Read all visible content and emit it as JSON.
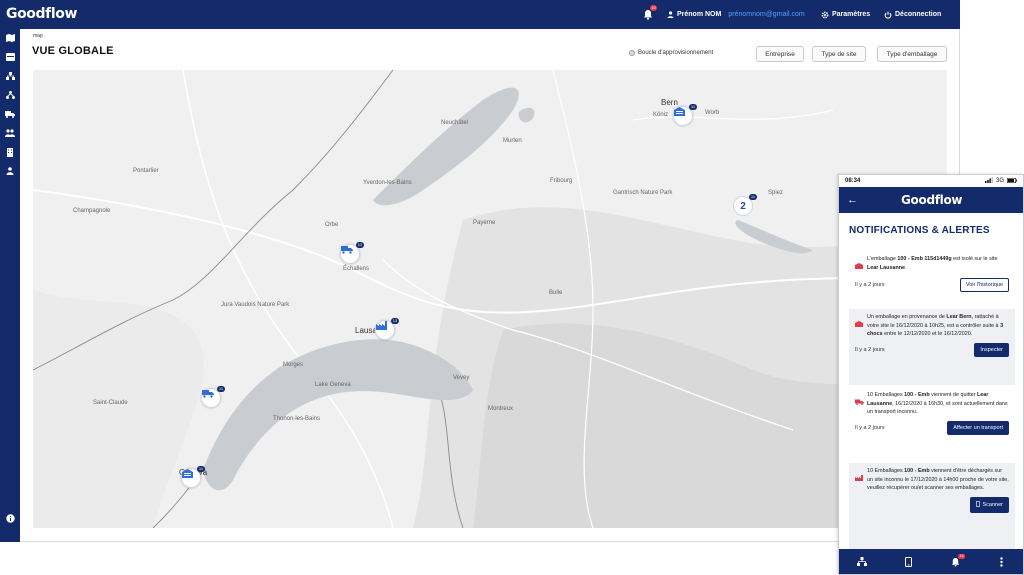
{
  "app": {
    "brand": "Goodflow"
  },
  "topbar": {
    "notification_count": "10",
    "user_name": "Prénom NOM",
    "user_email": "prénomnom@gmail.com",
    "settings_label": "Paramètres",
    "logout_label": "Déconnection"
  },
  "sidebar": {
    "items": [
      "map-icon",
      "inventory-icon",
      "network-icon",
      "hierarchy-icon",
      "truck-icon",
      "team-icon",
      "building-icon",
      "users-icon",
      "info-icon"
    ]
  },
  "page": {
    "breadcrumb": "map",
    "title": "VUE GLOBALE",
    "loop_label": "Boucle d'approvisionnement",
    "filters": [
      "Entreprise",
      "Type de site",
      "Type d'emballage"
    ]
  },
  "map": {
    "cities": [
      "Bern",
      "Köniz",
      "Worb",
      "Fribourg",
      "Yverdon-les-Bains",
      "Lausanne",
      "Geneva",
      "Lake Geneva",
      "Neuchâtel",
      "Morges",
      "Vevey",
      "Bulle",
      "Pontarlier",
      "Thonon-les-Bains",
      "Échallens",
      "Orbe",
      "Spiez",
      "Gantrisch Nature Park",
      "Jura Vaudois Nature Park",
      "Champagnole",
      "Saint-Claude",
      "Montreux",
      "Murten",
      "Payerne"
    ],
    "markers": [
      {
        "icon": "warehouse-icon",
        "badge": "11"
      },
      {
        "icon": "truck-icon",
        "badge": "12"
      },
      {
        "icon": "factory-icon",
        "badge": "13"
      },
      {
        "icon": "truck-icon",
        "badge": "11"
      },
      {
        "icon": "warehouse-icon",
        "badge": "11"
      }
    ],
    "cluster_count": "2",
    "cluster_badge": "11"
  },
  "phone": {
    "time": "08:34",
    "signal": "3G",
    "brand": "Goodflow",
    "title": "NOTIFICATIONS & ALERTES",
    "cards": [
      {
        "parts": [
          "L'emballage ",
          "100 - Emb 115d1449g",
          " est isolé sur le site ",
          "Lear Lausanne",
          "."
        ],
        "time": "Il y a 2 jours",
        "action": "Voir l'historique"
      },
      {
        "parts": [
          "Un emballage en provenance de ",
          "Lear Bern",
          ", rattaché à votre site le 16/12/2020 à 10h25, est a contrôler suite à ",
          "3 chocs",
          " entre le 12/12/2020 et le 16/12/2020."
        ],
        "time": "Il y a 2 jours",
        "action": "Inspecter"
      },
      {
        "parts": [
          "10 Emballages ",
          "100 - Emb",
          " viennent de quitter ",
          "Lear Lausanne",
          ", 16/12/2020 à 16h30, et sont actuellement dans un transport inconnu."
        ],
        "time": "Il y a 2 jours",
        "action": "Affecter un transport"
      },
      {
        "parts": [
          "10 Emballages ",
          "100 - Emb",
          " viennent d'être déchargés sur un site inconnu le 17/12/2020 à 14h00 proche de votre site, veuillez récupérer ou/et scanner ses emballages.",
          "",
          ""
        ],
        "time": "",
        "action": "Scanner"
      }
    ],
    "nav_badge": "10",
    "nav": [
      "network-icon",
      "phone-icon",
      "bell-icon",
      "more-icon"
    ]
  }
}
